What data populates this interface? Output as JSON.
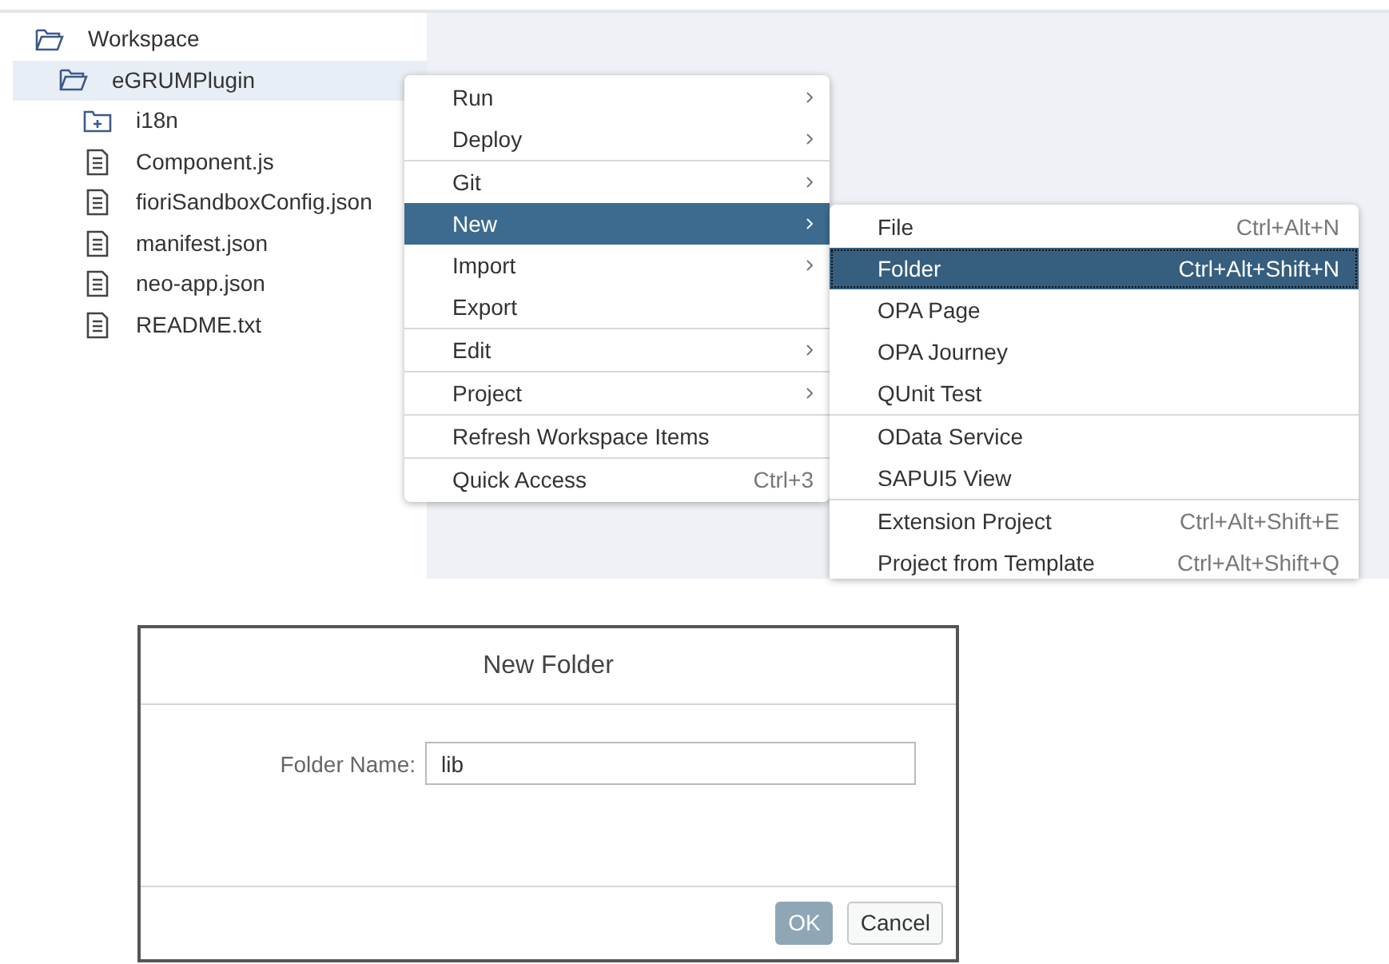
{
  "tree": [
    {
      "label": "Workspace",
      "kind": "folder_open",
      "selected": false,
      "children": [
        {
          "label": "eGRUMPlugin",
          "kind": "folder_open",
          "selected": true,
          "children": [
            {
              "label": "i18n",
              "kind": "folder",
              "selected": false
            },
            {
              "label": "Component.js",
              "kind": "file",
              "selected": false
            },
            {
              "label": "fioriSandboxConfig.json",
              "kind": "file",
              "selected": false
            },
            {
              "label": "manifest.json",
              "kind": "file",
              "selected": false
            },
            {
              "label": "neo-app.json",
              "kind": "file",
              "selected": false
            },
            {
              "label": "README.txt",
              "kind": "file",
              "selected": false
            }
          ]
        }
      ]
    }
  ],
  "context_menu": {
    "groups": [
      [
        {
          "label": "Run",
          "submenu": true,
          "selected": false
        },
        {
          "label": "Deploy",
          "submenu": true,
          "selected": false
        }
      ],
      [
        {
          "label": "Git",
          "submenu": true,
          "selected": false
        },
        {
          "label": "New",
          "submenu": true,
          "selected": true
        },
        {
          "label": "Import",
          "submenu": true,
          "selected": false
        },
        {
          "label": "Export",
          "submenu": false,
          "selected": false
        }
      ],
      [
        {
          "label": "Edit",
          "submenu": true,
          "selected": false
        }
      ],
      [
        {
          "label": "Project",
          "submenu": true,
          "selected": false
        }
      ],
      [
        {
          "label": "Refresh Workspace Items",
          "submenu": false,
          "selected": false
        }
      ],
      [
        {
          "label": "Quick Access",
          "shortcut": "Ctrl+3",
          "submenu": false,
          "selected": false
        }
      ]
    ]
  },
  "submenu": {
    "groups": [
      [
        {
          "label": "File",
          "shortcut": "Ctrl+Alt+N",
          "selected": false
        },
        {
          "label": "Folder",
          "shortcut": "Ctrl+Alt+Shift+N",
          "selected": true
        },
        {
          "label": "OPA Page",
          "selected": false
        },
        {
          "label": "OPA Journey",
          "selected": false
        },
        {
          "label": "QUnit Test",
          "selected": false
        }
      ],
      [
        {
          "label": "OData Service",
          "selected": false
        },
        {
          "label": "SAPUI5 View",
          "selected": false
        }
      ],
      [
        {
          "label": "Extension Project",
          "shortcut": "Ctrl+Alt+Shift+E",
          "selected": false
        },
        {
          "label": "Project from Template",
          "shortcut": "Ctrl+Alt+Shift+Q",
          "selected": false
        }
      ]
    ]
  },
  "dialog": {
    "title": "New Folder",
    "field": {
      "label": "Folder Name:",
      "value": "lib"
    },
    "buttons": [
      {
        "label": "OK",
        "kind": "primary"
      },
      {
        "label": "Cancel",
        "kind": "secondary"
      }
    ]
  }
}
